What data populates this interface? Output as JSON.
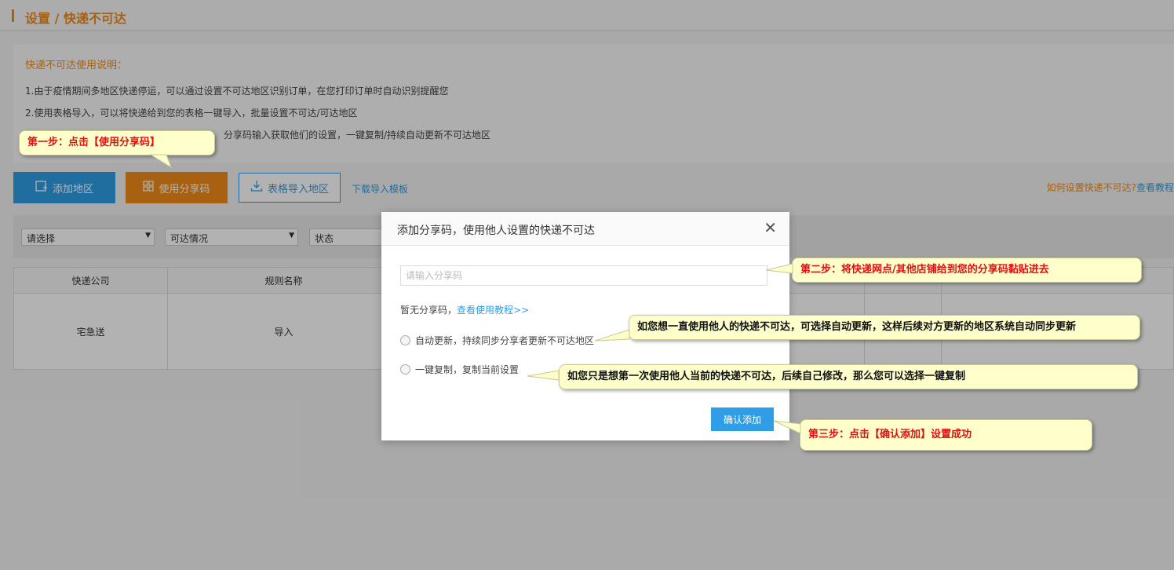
{
  "header": {
    "title": "设置 / 快递不可达"
  },
  "info": {
    "heading": "快递不可达使用说明：",
    "line1": "1.由于疫情期间多地区快递停运，可以通过设置不可达地区识别订单，在您打印订单时自动识别提醒您",
    "line2": "2.使用表格导入，可以将快递给到您的表格一键导入，批量设置不可达/可达地区",
    "line3": "分享码输入获取他们的设置，一键复制/持续自动更新不可达地区"
  },
  "toolbar": {
    "add_region": "添加地区",
    "use_share_code": "使用分享码",
    "import_table": "表格导入地区",
    "download_template": "下载导入模板",
    "help_text": "如何设置快递不可达?",
    "help_link": "查看教程"
  },
  "filters": {
    "select1": "请选择",
    "select2": "可达情况",
    "select3": "状态"
  },
  "table": {
    "headers": [
      "快递公司",
      "规则名称"
    ],
    "row": [
      "宅急送",
      "导入"
    ]
  },
  "modal": {
    "title": "添加分享码，使用他人设置的快递不可达",
    "placeholder": "请输入分享码",
    "no_code": "暂无分享码，",
    "tutorial_link": "查看使用教程>>",
    "option_auto": "自动更新，持续同步分享者更新不可达地区",
    "option_copy": "一键复制，复制当前设置",
    "confirm": "确认添加"
  },
  "tips": {
    "step1": "第一步：点击【使用分享码】",
    "step2": "第二步：将快递网点/其他店铺给到您的分享码黏贴进去",
    "auto_hint": "如您想一直使用他人的快递不可达，可选择自动更新，这样后续对方更新的地区系统自动同步更新",
    "copy_hint": "如您只是想第一次使用他人当前的快递不可达，后续自己修改，那么您可以选择一键复制",
    "step3": "第三步：点击【确认添加】设置成功"
  },
  "colors": {
    "accent": "#ee8a1b",
    "primary": "#2f9ee6",
    "tip_bg": "#ffffcc",
    "tip_red": "#dd1111"
  },
  "icons": {
    "add_region": "add-square-icon",
    "share": "grid-icon",
    "import": "download-icon",
    "close": "close-icon"
  }
}
